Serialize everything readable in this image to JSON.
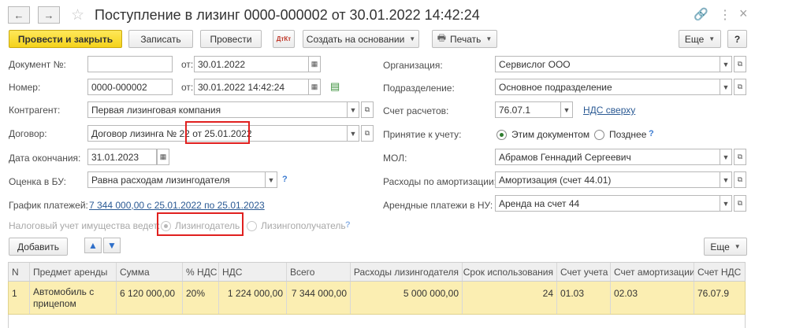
{
  "header": {
    "title": "Поступление в лизинг 0000-000002 от 30.01.2022 14:42:24",
    "back_glyph": "←",
    "forward_glyph": "→",
    "star_glyph": "☆",
    "link_glyph": "🔗",
    "more_glyph": "⋮",
    "close_glyph": "×"
  },
  "toolbar": {
    "post_close": "Провести и закрыть",
    "save": "Записать",
    "post": "Провести",
    "dtkt": "ДтКт",
    "create_based": "Создать на основании",
    "print": "Печать",
    "more": "Еще",
    "help": "?"
  },
  "form": {
    "doc_no_label": "Документ №:",
    "doc_no_value": "",
    "from_label": "от:",
    "doc_date": "30.01.2022",
    "number_label": "Номер:",
    "number_value": "0000-000002",
    "from_label2": "от:",
    "number_date": "30.01.2022 14:42:24",
    "contractor_label": "Контрагент:",
    "contractor_value": "Первая лизинговая компания",
    "contract_label": "Договор:",
    "contract_value": "Договор лизинга № 22 от 25.01.2022",
    "end_date_label": "Дата окончания:",
    "end_date_value": "31.01.2023",
    "bu_label": "Оценка в БУ:",
    "bu_value": "Равна расходам лизингодателя",
    "schedule_label": "График платежей:",
    "schedule_link": "7 344 000,00 с 25.01.2022 по 25.01.2023",
    "tax_label": "Налоговый учет имущества ведет:",
    "tax_opt1": "Лизингодатель",
    "tax_opt2": "Лизингополучатель",
    "org_label": "Организация:",
    "org_value": "Сервислог ООО",
    "dept_label": "Подразделение:",
    "dept_value": "Основное подразделение",
    "account_label": "Счет расчетов:",
    "account_value": "76.07.1",
    "vat_link": "НДС сверху",
    "accept_label": "Принятие к учету:",
    "accept_opt1": "Этим документом",
    "accept_opt2": "Позднее",
    "mol_label": "МОЛ:",
    "mol_value": "Абрамов Геннадий Сергеевич",
    "amort_label": "Расходы по амортизации:",
    "amort_value": "Амортизация (счет 44.01)",
    "rent_label": "Арендные платежи в НУ:",
    "rent_value": "Аренда на счет 44",
    "help_q": "?"
  },
  "table_toolbar": {
    "add": "Добавить",
    "more": "Еще"
  },
  "table": {
    "columns": [
      "N",
      "Предмет аренды",
      "Сумма",
      "% НДС",
      "НДС",
      "Всего",
      "Расходы лизингодателя",
      "Срок использования",
      "Счет учета",
      "Счет амортизации",
      "Счет НДС"
    ],
    "rows": [
      [
        "1",
        "Автомобиль с прицепом",
        "6 120 000,00",
        "20%",
        "1 224 000,00",
        "7 344 000,00",
        "5 000 000,00",
        "24",
        "01.03",
        "02.03",
        "76.07.9"
      ]
    ]
  },
  "colors": {
    "primary_button": "#f4d21a",
    "selected_row": "#fbeeb2",
    "highlight_box": "#e0201f",
    "link": "#2b5a94"
  }
}
